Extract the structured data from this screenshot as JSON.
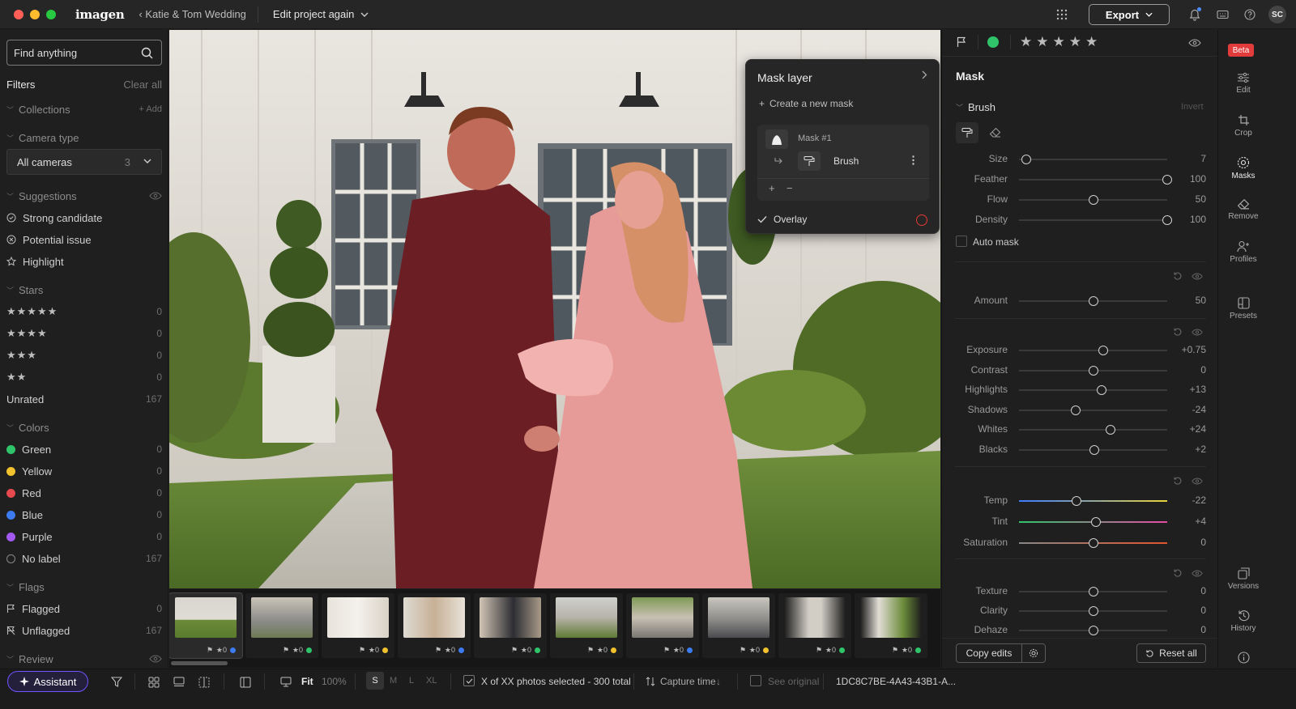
{
  "topbar": {
    "app_name": "imagen",
    "breadcrumb": "‹ Katie & Tom Wedding",
    "project": "Edit project again",
    "export_label": "Export",
    "avatar_initials": "SC"
  },
  "sidebar": {
    "search_placeholder": "Find anything",
    "filters_label": "Filters",
    "clear_all": "Clear all",
    "collections": "Collections",
    "add": "+ Add",
    "camera_type": "Camera type",
    "camera_value": "All cameras",
    "camera_count": "3",
    "suggestions": "Suggestions",
    "suggestion_items": [
      "Strong candidate",
      "Potential issue",
      "Highlight"
    ],
    "stars_label": "Stars",
    "star_rows": [
      {
        "stars": "★★★★★",
        "count": "0"
      },
      {
        "stars": "★★★★",
        "count": "0"
      },
      {
        "stars": "★★★",
        "count": "0"
      },
      {
        "stars": "★★",
        "count": "0"
      }
    ],
    "unrated": {
      "label": "Unrated",
      "count": "167"
    },
    "colors_label": "Colors",
    "colors": [
      {
        "label": "Green",
        "count": "0",
        "color": "#2fc46a"
      },
      {
        "label": "Yellow",
        "count": "0",
        "color": "#f2c12e"
      },
      {
        "label": "Red",
        "count": "0",
        "color": "#e5484d"
      },
      {
        "label": "Blue",
        "count": "0",
        "color": "#3d7cf0"
      },
      {
        "label": "Purple",
        "count": "0",
        "color": "#a259f0"
      },
      {
        "label": "No label",
        "count": "167",
        "color": "none"
      }
    ],
    "flags_label": "Flags",
    "flags": [
      {
        "label": "Flagged",
        "count": "0"
      },
      {
        "label": "Unflagged",
        "count": "167"
      }
    ],
    "review_label": "Review"
  },
  "mask_panel": {
    "title": "Mask layer",
    "create": "Create a new mask",
    "mask_name": "Mask #1",
    "tool": "Brush",
    "overlay": "Overlay"
  },
  "filmstrip": {
    "thumbs": [
      {
        "stars": "★0",
        "dot": "#3d7cf0"
      },
      {
        "stars": "★0",
        "dot": "#2fc46a"
      },
      {
        "stars": "★0",
        "dot": "#f2c12e"
      },
      {
        "stars": "★0",
        "dot": "#3d7cf0"
      },
      {
        "stars": "★0",
        "dot": "#2fc46a"
      },
      {
        "stars": "★0",
        "dot": "#f2c12e"
      },
      {
        "stars": "★0",
        "dot": "#3d7cf0"
      },
      {
        "stars": "★0",
        "dot": "#f2c12e"
      },
      {
        "stars": "★0",
        "dot": "#2fc46a"
      },
      {
        "stars": "★0",
        "dot": "#2fc46a"
      }
    ]
  },
  "bottombar": {
    "assistant": "Assistant",
    "fit": "Fit",
    "zoom": "100%",
    "sizes": [
      "S",
      "M",
      "L",
      "XL"
    ],
    "selection": "X of XX photos selected - 300 total",
    "sort": "Capture time",
    "see_original": "See original",
    "file_id": "1DC8C7BE-4A43-43B1-A..."
  },
  "right_panel": {
    "mask_title": "Mask",
    "brush_label": "Brush",
    "invert": "Invert",
    "auto_mask": "Auto mask",
    "copy_edits": "Copy edits",
    "reset_all": "Reset all",
    "brush_sliders": [
      {
        "label": "Size",
        "value": "7",
        "pos": 0.05
      },
      {
        "label": "Feather",
        "value": "100",
        "pos": 1.0
      },
      {
        "label": "Flow",
        "value": "50",
        "pos": 0.5
      },
      {
        "label": "Density",
        "value": "100",
        "pos": 1.0
      }
    ],
    "amount": {
      "label": "Amount",
      "value": "50",
      "pos": 0.5
    },
    "tone_sliders": [
      {
        "label": "Exposure",
        "value": "+0.75",
        "pos": 0.57
      },
      {
        "label": "Contrast",
        "value": "0",
        "pos": 0.5
      },
      {
        "label": "Highlights",
        "value": "+13",
        "pos": 0.56
      },
      {
        "label": "Shadows",
        "value": "-24",
        "pos": 0.38
      },
      {
        "label": "Whites",
        "value": "+24",
        "pos": 0.62
      },
      {
        "label": "Blacks",
        "value": "+2",
        "pos": 0.51
      }
    ],
    "color_sliders": [
      {
        "label": "Temp",
        "value": "-22",
        "pos": 0.39
      },
      {
        "label": "Tint",
        "value": "+4",
        "pos": 0.52
      },
      {
        "label": "Saturation",
        "value": "0",
        "pos": 0.5
      }
    ],
    "detail_sliders": [
      {
        "label": "Texture",
        "value": "0",
        "pos": 0.5
      },
      {
        "label": "Clarity",
        "value": "0",
        "pos": 0.5
      },
      {
        "label": "Dehaze",
        "value": "0",
        "pos": 0.5
      }
    ]
  },
  "rail": {
    "beta": "Beta",
    "items": [
      "Edit",
      "Crop",
      "Masks",
      "Remove",
      "Profiles",
      "Presets"
    ],
    "bottom_items": [
      "Versions",
      "History"
    ]
  }
}
